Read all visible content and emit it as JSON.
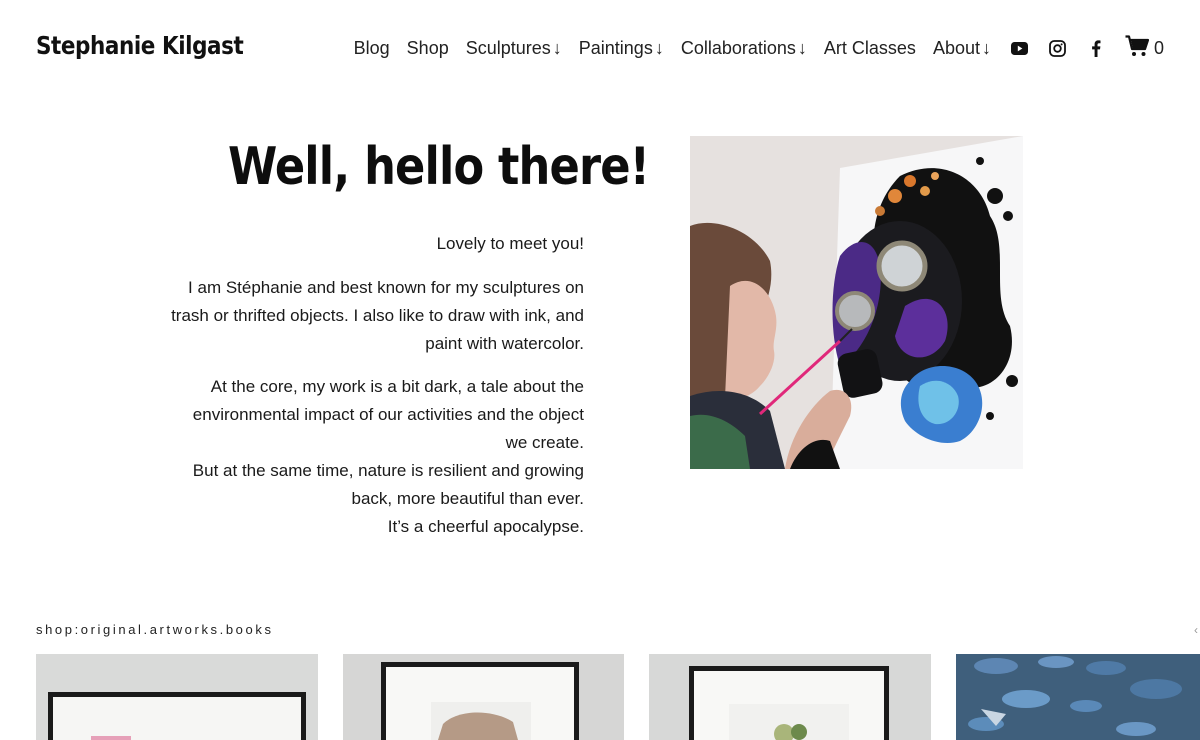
{
  "site": {
    "title": "Stephanie Kilgast"
  },
  "nav": {
    "items": [
      {
        "label": "Blog",
        "arrow": ""
      },
      {
        "label": "Shop",
        "arrow": ""
      },
      {
        "label": "Sculptures",
        "arrow": "↓"
      },
      {
        "label": "Paintings",
        "arrow": "↓"
      },
      {
        "label": "Collaborations",
        "arrow": "↓"
      },
      {
        "label": "Art Classes",
        "arrow": ""
      },
      {
        "label": "About",
        "arrow": "↓"
      }
    ],
    "social_icons": [
      "youtube-icon",
      "instagram-icon",
      "facebook-icon"
    ],
    "cart": {
      "icon": "cart-icon",
      "count": "0"
    }
  },
  "intro": {
    "headline": "Well, hello there!",
    "greeting": "Lovely to meet you!",
    "paragraph_1": "I am Stéphanie and best known for my sculptures on trash or thrifted objects. I also like to draw with ink, and paint with watercolor.",
    "paragraph_2_lines": [
      "At the core, my work is a bit dark, a tale about the environmental impact of our activities and the object we create.",
      "But at the same time, nature is resilient and growing back, more beautiful than ever.",
      "It’s a cheerful apocalypse."
    ]
  },
  "shop": {
    "label": "shop:original.artworks.books",
    "arrow": "‹"
  },
  "colors": {
    "text": "#111111",
    "background": "#ffffff",
    "accent_pink": "#e0287a",
    "coral_blue": "#3a7ed0"
  }
}
